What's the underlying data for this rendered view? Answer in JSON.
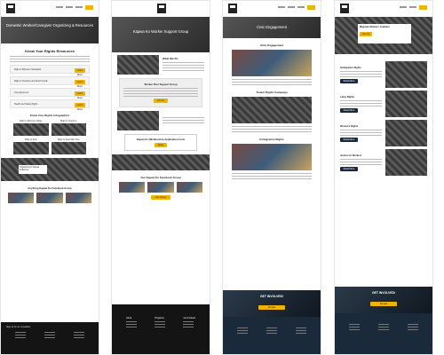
{
  "brand": {
    "accent": "#f0b400",
    "dark": "#141414",
    "navy": "#1b2a3a"
  },
  "nav": {
    "join_label": ""
  },
  "page1": {
    "hero_title": "Domestic Worker/Caregiver Organizing & Resources",
    "section_title": "Know Your Rights Resources",
    "cards": [
      {
        "label": "Right to Minimum Standards",
        "button": "Learn More"
      },
      {
        "label": "Right to Overtime and Rest Periods",
        "button": "Learn More"
      },
      {
        "label": "Unemployment",
        "button": "Learn More"
      },
      {
        "label": "Health and Safety Rights",
        "button": "Learn More"
      }
    ],
    "grid_title": "Know Your Rights Infographics",
    "grid_items": [
      "Right to Minimum Wage",
      "Right to Overtime",
      "Right to Rest",
      "Right to Paid Sick Time"
    ],
    "banner_text": "Organizing in Kapwa Kollective",
    "fb_title": "Anything Kapwa Ko Facebook Group",
    "newsletter": "Sign up for our newsletter"
  },
  "page2": {
    "hero_title": "Kapwa Ko Worker Support Group",
    "what_title": "What We Do",
    "quote_title": "Worker Peer Support Group",
    "quote_button": "Join Us",
    "meeting_title": "Kapwa Ko Membership Application Form",
    "meeting_button": "Apply",
    "fb_title": "Our Kapwa Ko Facebook Group",
    "fb_button": "Join Group",
    "footer_heads": [
      "About",
      "Programs",
      "Get Involved"
    ]
  },
  "page3": {
    "hero_title": "Civic Engagement",
    "sections": [
      "Voter Engagement",
      "Tenant Rights Campaign",
      "Immigration Rights"
    ],
    "involved_title": "GET INVOLVED!",
    "involved_button": "Donate"
  },
  "page4": {
    "hero_title": "Migrante Workers Coalition",
    "hero_button": "Join Us",
    "items": [
      {
        "title": "Immigration Rights",
        "button": "Read More"
      },
      {
        "title": "Labor Rights",
        "button": "Read More"
      },
      {
        "title": "Women's Rights",
        "button": "Read More"
      },
      {
        "title": "Justice for Workers",
        "button": "Read More"
      }
    ],
    "involved_title": "GET INVOLVED!",
    "involved_button": "Donate"
  }
}
